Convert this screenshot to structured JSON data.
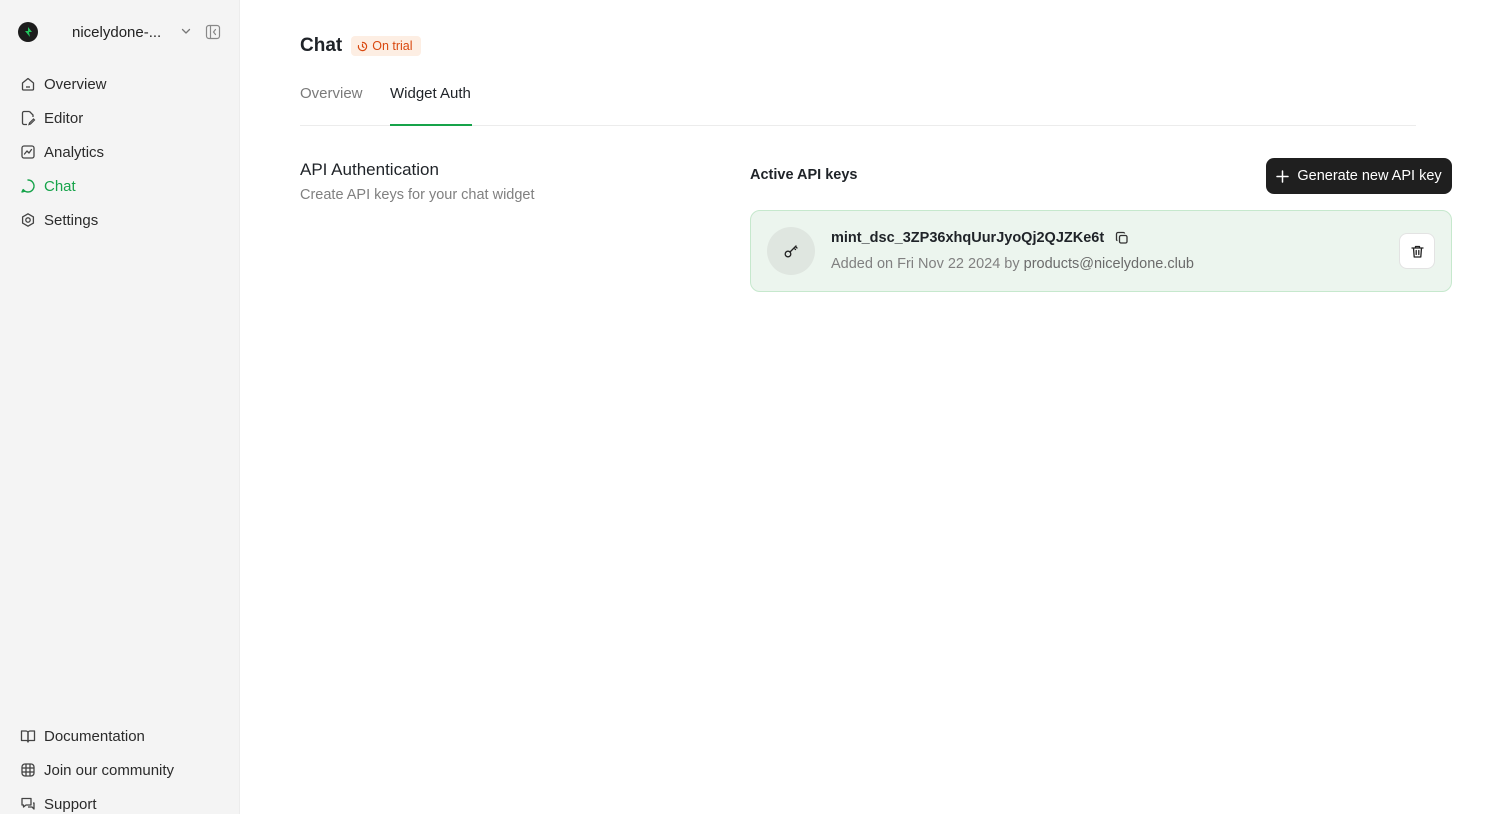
{
  "sidebar": {
    "org_name": "nicelydone-...",
    "nav": [
      {
        "label": "Overview",
        "icon": "home-icon"
      },
      {
        "label": "Editor",
        "icon": "file-edit-icon"
      },
      {
        "label": "Analytics",
        "icon": "chart-icon"
      },
      {
        "label": "Chat",
        "icon": "chat-icon",
        "active": true
      },
      {
        "label": "Settings",
        "icon": "gear-icon"
      }
    ],
    "footer": [
      {
        "label": "Documentation",
        "icon": "book-icon"
      },
      {
        "label": "Join our community",
        "icon": "community-icon"
      },
      {
        "label": "Support",
        "icon": "support-icon"
      }
    ]
  },
  "header": {
    "title": "Chat",
    "badge": "On trial"
  },
  "tabs": [
    {
      "label": "Overview",
      "active": false
    },
    {
      "label": "Widget Auth",
      "active": true
    }
  ],
  "auth": {
    "title": "API Authentication",
    "description": "Create API keys for your chat widget"
  },
  "keys": {
    "title": "Active API keys",
    "generate_label": "Generate new API key",
    "items": [
      {
        "name": "mint_dsc_3ZP36xhqUurJyoQj2QJZKe6t",
        "added_prefix": "Added on Fri Nov 22 2024 by ",
        "added_by": "products@nicelydone.club"
      }
    ]
  },
  "colors": {
    "accent": "#16a34a",
    "sidebar_bg": "#f4f4f4",
    "key_card_bg": "#ecf5ee",
    "badge_bg": "#fdeee3",
    "badge_text": "#d9480f"
  }
}
